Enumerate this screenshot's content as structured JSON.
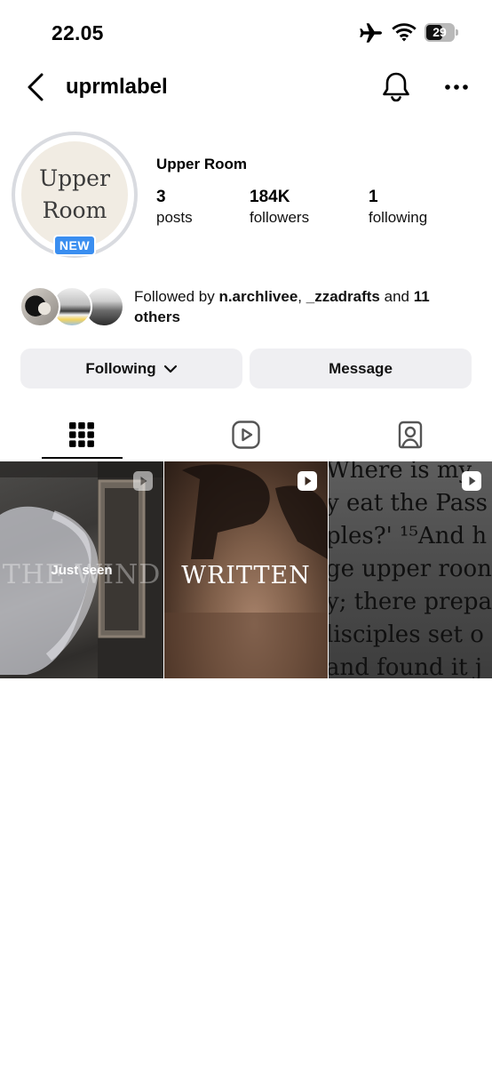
{
  "status_bar": {
    "time": "22.05",
    "battery_level": "29",
    "icons": [
      "airplane-icon",
      "wifi-icon",
      "battery-icon"
    ]
  },
  "header": {
    "username": "uprmlabel",
    "icons": [
      "back-arrow-icon",
      "bell-icon",
      "more-icon"
    ]
  },
  "profile": {
    "avatar_text": [
      "Upper",
      "Room"
    ],
    "new_badge": "NEW",
    "display_name": "Upper Room",
    "stats": [
      {
        "value": "3",
        "label": "posts"
      },
      {
        "value": "184K",
        "label": "followers"
      },
      {
        "value": "1",
        "label": "following"
      }
    ]
  },
  "followed_by": {
    "prefix": "Followed by",
    "user1": "n.archlivee",
    "separator": ",",
    "user2": "_zzadrafts",
    "connector": "and",
    "others": "11 others"
  },
  "actions": {
    "following_label": "Following",
    "message_label": "Message"
  },
  "tabs": [
    {
      "icon": "grid-icon",
      "active": true
    },
    {
      "icon": "reels-icon",
      "active": false
    },
    {
      "icon": "tagged-icon",
      "active": false
    }
  ],
  "posts": [
    {
      "overlay_text": "THE WIND",
      "status": "Just seen",
      "type": "reel"
    },
    {
      "overlay_text": "WRITTEN",
      "type": "reel"
    },
    {
      "overlay_text": [
        "Where is my",
        "y eat the Pass",
        "ples?' ¹⁵And h",
        "ge upper roon",
        "y; there prepa",
        "lisciples set o",
        "and found it j"
      ],
      "type": "reel"
    }
  ],
  "colors": {
    "badge_blue": "#3a8ef0",
    "button_bg": "#efeff2",
    "ring_gray": "#d9dbe0"
  }
}
